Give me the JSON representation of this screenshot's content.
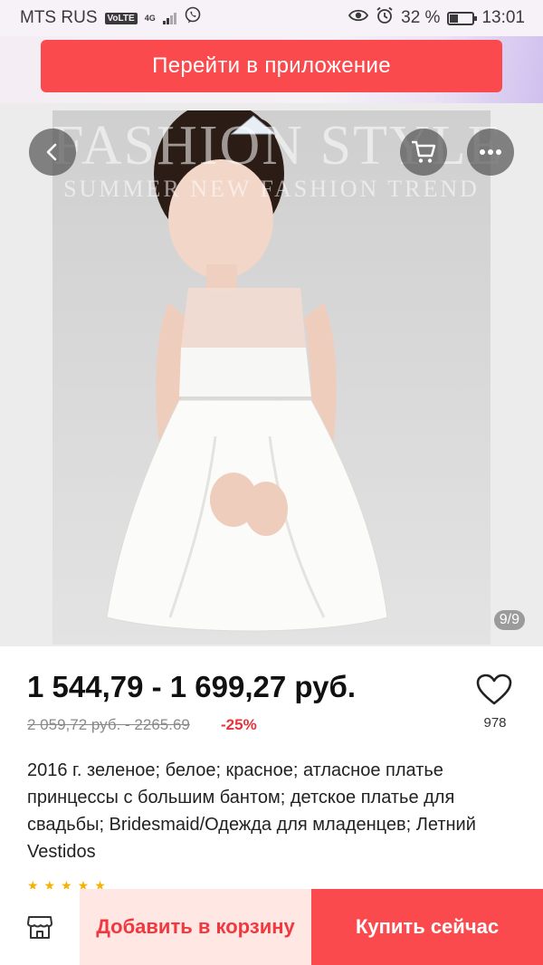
{
  "status_bar": {
    "carrier": "MTS RUS",
    "volte": "VoLTE",
    "network": "4G",
    "battery": "32 %",
    "battery_level": 0.32,
    "time": "13:01",
    "icons": [
      "viber-icon",
      "eye-icon",
      "alarm-icon",
      "battery-icon",
      "signal-icon"
    ]
  },
  "banner": {
    "open_app_label": "Перейти в приложение"
  },
  "gallery": {
    "watermark_line1": "FASHION STYLE",
    "watermark_line2": "SUMMER NEW FASHION TREND",
    "counter": "9/9"
  },
  "product": {
    "price_range": "1 544,79 - 1 699,27 руб.",
    "old_price": "2 059,72 руб. - 2265.69",
    "discount": "-25%",
    "wishlist_count": "978",
    "title": "2016 г. зеленое; белое; красное; атласное платье принцессы с большим бантом; детское платье для свадьбы; Bridesmaid/Одежда для младенцев; Летний Vestidos"
  },
  "bottom_bar": {
    "add_to_cart_label": "Добавить в корзину",
    "buy_now_label": "Купить сейчас"
  },
  "colors": {
    "accent": "#fb4a4d",
    "accent_light": "#ffe8e4",
    "discount": "#e8333b"
  }
}
